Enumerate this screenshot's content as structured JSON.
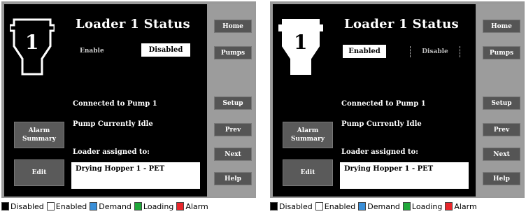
{
  "screens": {
    "left": {
      "title": "Loader  1 Status",
      "loader_number": "1",
      "enable_label": "Enable",
      "status_value": "Disabled",
      "connected": "Connected to Pump   1",
      "pump_status": "Pump Currently Idle",
      "assigned_label": "Loader assigned to:",
      "assigned_value": "Drying Hopper 1 - PET",
      "alarm_summary": "Alarm Summary",
      "edit": "Edit"
    },
    "right": {
      "title": "Loader  1 Status",
      "loader_number": "1",
      "enabled_value": "Enabled",
      "disable_label": "Disable",
      "connected": "Connected to Pump   1",
      "pump_status": "Pump Currently Idle",
      "assigned_label": "Loader assigned to:",
      "assigned_value": "Drying Hopper 1 - PET",
      "alarm_summary": "Alarm Summary",
      "edit": "Edit"
    }
  },
  "sidebar": {
    "home": "Home",
    "pumps": "Pumps",
    "setup": "Setup",
    "prev": "Prev",
    "next": "Next",
    "help": "Help"
  },
  "legend": [
    {
      "label": "Disabled",
      "color": "#000000"
    },
    {
      "label": "Enabled",
      "color": "#ffffff"
    },
    {
      "label": "Demand",
      "color": "#3a8fd8"
    },
    {
      "label": "Loading",
      "color": "#1fa83a"
    },
    {
      "label": "Alarm",
      "color": "#e8262b"
    }
  ],
  "colors": {
    "panel": "#000000",
    "frame": "#9a9a9a",
    "button": "#555555"
  }
}
